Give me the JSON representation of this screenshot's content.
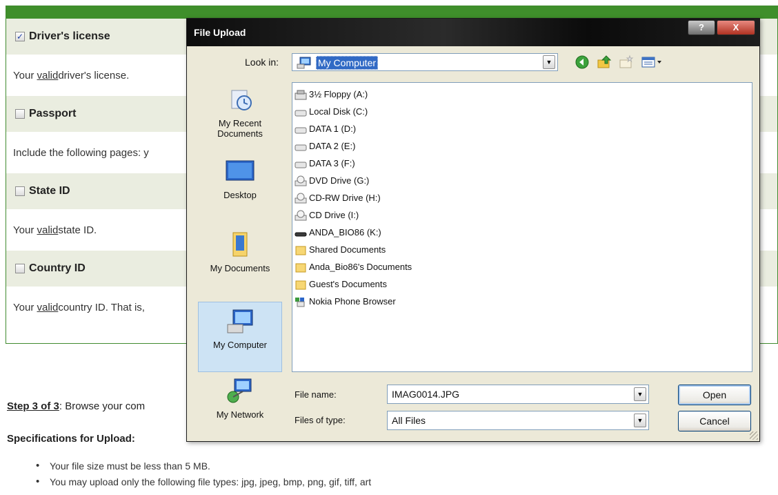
{
  "page": {
    "sections": [
      {
        "label": "Driver's license",
        "checked": true,
        "desc_pre": "Your ",
        "desc_link": "valid",
        "desc_post": " driver's license."
      },
      {
        "label": "Passport",
        "checked": false,
        "desc_pre": "Include the following pages: y",
        "desc_link": "",
        "desc_post": ""
      },
      {
        "label": "State ID",
        "checked": false,
        "desc_pre": "Your ",
        "desc_link": "valid",
        "desc_post": " state ID."
      },
      {
        "label": "Country ID",
        "checked": false,
        "desc_pre": "Your ",
        "desc_link": "valid",
        "desc_post": " country ID. That is,"
      }
    ],
    "step_bold": "Step 3 of 3",
    "step_rest": ": Browse your com",
    "spec_title": "Specifications for Upload:",
    "spec_items": [
      "Your file size must be less than 5 MB.",
      "You may upload only the following file types: jpg, jpeg, bmp, png, gif, tiff, art"
    ]
  },
  "dialog": {
    "title": "File Upload",
    "help_label": "?",
    "close_label": "X",
    "look_in_label": "Look in:",
    "look_in_value": "My Computer",
    "nav_icons": [
      "back-icon",
      "up-folder-icon",
      "new-folder-icon",
      "views-menu-icon"
    ],
    "places": [
      {
        "label": "My Recent Documents",
        "icon": "recent-documents-icon"
      },
      {
        "label": "Desktop",
        "icon": "desktop-icon"
      },
      {
        "label": "My Documents",
        "icon": "my-documents-icon"
      },
      {
        "label": "My Computer",
        "icon": "my-computer-icon",
        "active": true
      },
      {
        "label": "My Network",
        "icon": "my-network-icon"
      }
    ],
    "files": [
      {
        "name": "3½ Floppy (A:)",
        "icon": "floppy-drive-icon"
      },
      {
        "name": "Local Disk (C:)",
        "icon": "hard-disk-icon"
      },
      {
        "name": "DATA 1 (D:)",
        "icon": "hard-disk-icon"
      },
      {
        "name": "DATA 2 (E:)",
        "icon": "hard-disk-icon"
      },
      {
        "name": "DATA 3 (F:)",
        "icon": "hard-disk-icon"
      },
      {
        "name": "DVD Drive (G:)",
        "icon": "optical-drive-icon"
      },
      {
        "name": "CD-RW Drive (H:)",
        "icon": "optical-drive-icon"
      },
      {
        "name": "CD Drive (I:)",
        "icon": "optical-drive-icon"
      },
      {
        "name": "ANDA_BIO86 (K:)",
        "icon": "removable-drive-icon"
      },
      {
        "name": "Shared Documents",
        "icon": "folder-icon"
      },
      {
        "name": "Anda_Bio86's Documents",
        "icon": "folder-icon"
      },
      {
        "name": "Guest's Documents",
        "icon": "folder-icon"
      },
      {
        "name": "Nokia Phone Browser",
        "icon": "phone-browser-icon"
      }
    ],
    "file_name_label": "File name:",
    "file_name_value": "IMAG0014.JPG",
    "file_type_label": "Files of type:",
    "file_type_value": "All Files",
    "open_label": "Open",
    "cancel_label": "Cancel"
  },
  "colors": {
    "header_green": "#3f8f2b",
    "section_bg": "#eaede0",
    "selection_blue": "#316ac5",
    "dialog_face": "#ece9d8"
  }
}
